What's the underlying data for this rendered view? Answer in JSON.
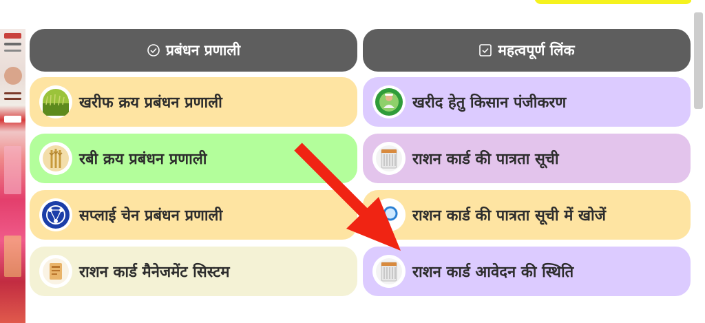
{
  "colors": {
    "header_bg": "#5e5e5e",
    "annotation_arrow": "#f02413",
    "top_tab": "#f5f21e"
  },
  "left_panel": {
    "title": "प्रबंधन प्रणाली",
    "title_icon": "check-circle-icon",
    "items": [
      {
        "label": "खरीफ क्रय प्रबंधन प्रणाली",
        "icon": "paddy-field-icon",
        "bg": "#fee4a2"
      },
      {
        "label": "रबी क्रय प्रबंधन प्रणाली",
        "icon": "wheat-icon",
        "bg": "#b3fe9b"
      },
      {
        "label": "सप्लाई चेन प्रबंधन प्रणाली",
        "icon": "supply-chain-globe-icon",
        "bg": "#fee4a2"
      },
      {
        "label": "राशन कार्ड मैनेजमेंट सिस्टम",
        "icon": "ration-card-logo-icon",
        "bg": "#f4f2d5"
      }
    ]
  },
  "right_panel": {
    "title": "महत्वपूर्ण लिंक",
    "title_icon": "check-square-icon",
    "items": [
      {
        "label": "खरीद हेतु किसान पंजीकरण",
        "icon": "farmer-icon",
        "bg": "#dccbff"
      },
      {
        "label": "राशन कार्ड की पात्रता सूची",
        "icon": "ration-list-icon",
        "bg": "#e3c4ec"
      },
      {
        "label": "राशन कार्ड की पात्रता सूची में खोजें",
        "icon": "search-magnifier-icon",
        "bg": "#fee4a2"
      },
      {
        "label": "राशन कार्ड आवेदन की स्थिति",
        "icon": "application-status-icon",
        "bg": "#dccbff"
      }
    ]
  }
}
